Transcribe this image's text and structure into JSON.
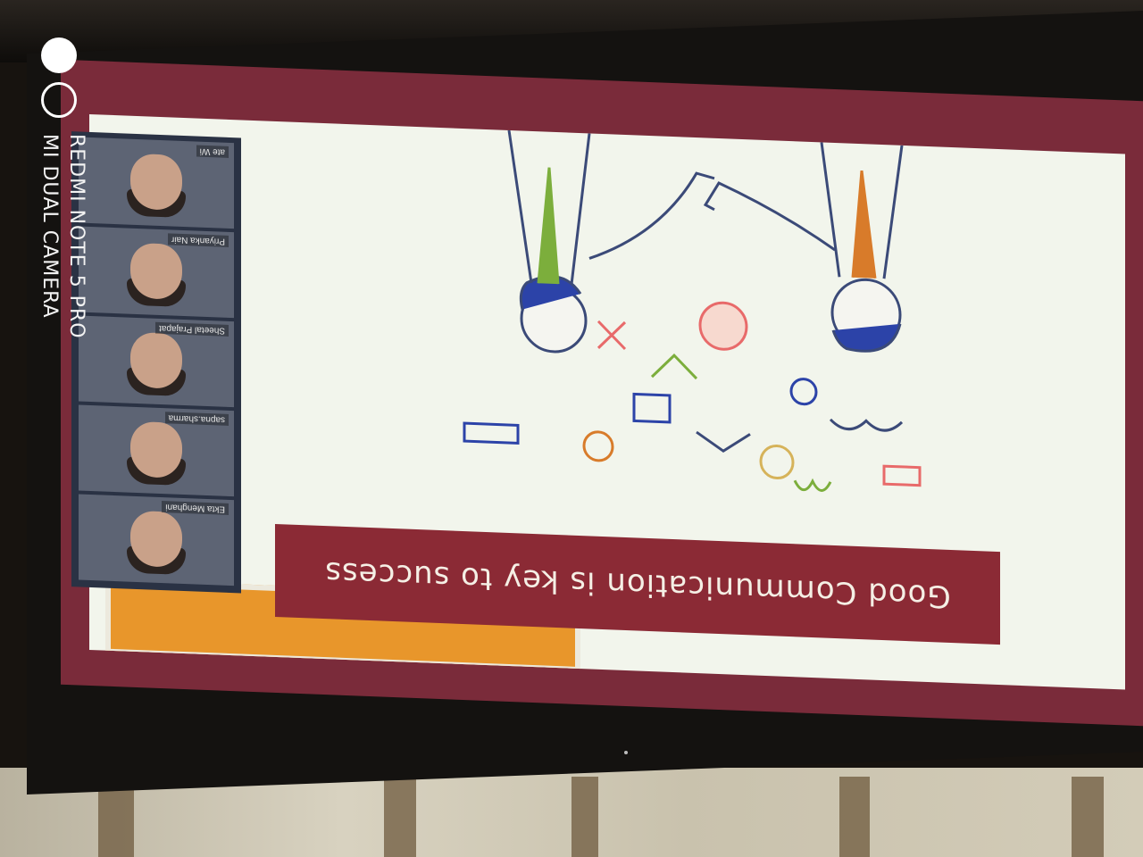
{
  "slide": {
    "title": "Good Communication is key to success"
  },
  "participants": [
    {
      "name": "Ekta Menghani"
    },
    {
      "name": "sapna.sharma"
    },
    {
      "name": "Sheetal Prajapat"
    },
    {
      "name": "Priyanka Nair"
    },
    {
      "name": ""
    }
  ],
  "panel_header": "ate Wi",
  "watermark": {
    "line1": "REDMI NOTE 5 PRO",
    "line2": "MI DUAL CAMERA"
  },
  "colors": {
    "title_bar": "#8b2a35",
    "slide_bg": "#f2f5ec",
    "frame": "#7a2b3a",
    "accent_box": "#e8962b"
  },
  "icons": [
    "person-left-icon",
    "person-right-icon",
    "cloud-network-icon",
    "lightbulb-icon",
    "dollar-icon",
    "chart-icon",
    "gear-icon"
  ]
}
